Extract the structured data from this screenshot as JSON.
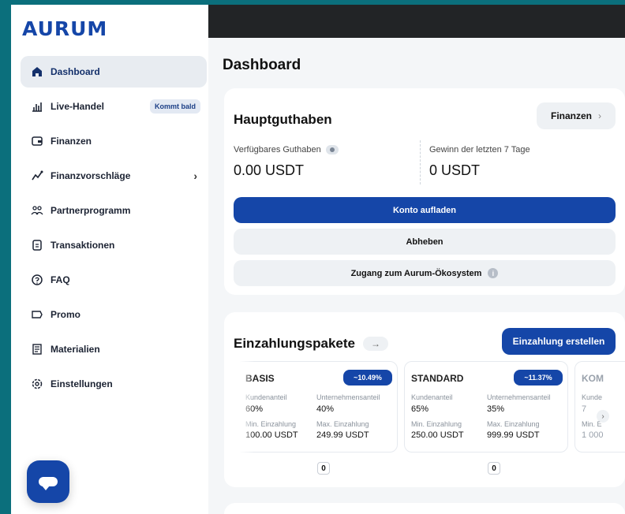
{
  "brand": {
    "logo": "AURUM",
    "color": "#1546a8"
  },
  "sidebar": {
    "items": [
      {
        "label": "Dashboard",
        "icon": "home-icon",
        "active": true
      },
      {
        "label": "Live-Handel",
        "icon": "bar-chart-icon",
        "badge": "Kommt bald"
      },
      {
        "label": "Finanzen",
        "icon": "wallet-icon"
      },
      {
        "label": "Finanzvorschläge",
        "icon": "trend-line-icon",
        "chevron": "›"
      },
      {
        "label": "Partnerprogramm",
        "icon": "partners-icon"
      },
      {
        "label": "Transaktionen",
        "icon": "document-icon"
      },
      {
        "label": "FAQ",
        "icon": "question-icon"
      },
      {
        "label": "Promo",
        "icon": "ticket-icon"
      },
      {
        "label": "Materialien",
        "icon": "materials-icon"
      },
      {
        "label": "Einstellungen",
        "icon": "settings-icon"
      }
    ],
    "chat_icon": "chat-icon"
  },
  "main": {
    "page_title": "Dashboard",
    "balance_card": {
      "title": "Hauptguthaben",
      "finance_button": "Finanzen",
      "finance_arrow": "›",
      "available_label": "Verfügbares Guthaben",
      "available_value": "0.00 USDT",
      "gain_label": "Gewinn der letzten 7 Tage",
      "gain_value": "0 USDT",
      "topup_button": "Konto aufladen",
      "withdraw_button": "Abheben",
      "ecosystem_button": "Zugang zum Aurum-Ökosystem",
      "info_glyph": "i"
    },
    "packages_card": {
      "title": "Einzahlungspakete",
      "title_arrow": "→",
      "create_button": "Einzahlung erstellen",
      "packages": [
        {
          "name": "BASIS",
          "rate": "~10.49%",
          "customer_label": "Kundenanteil",
          "customer_value": "60%",
          "company_label": "Unternehmensanteil",
          "company_value": "40%",
          "min_label": "Min. Einzahlung",
          "min_value": "100.00 USDT",
          "max_label": "Max. Einzahlung",
          "max_value": "249.99 USDT",
          "count": "0"
        },
        {
          "name": "STANDARD",
          "rate": "~11.37%",
          "customer_label": "Kundenanteil",
          "customer_value": "65%",
          "company_label": "Unternehmensanteil",
          "company_value": "35%",
          "min_label": "Min. Einzahlung",
          "min_value": "250.00 USDT",
          "max_label": "Max. Einzahlung",
          "max_value": "999.99 USDT",
          "count": "0"
        },
        {
          "name": "KOM",
          "customer_label": "Kunde",
          "customer_value": "7",
          "min_label": "Min. E",
          "min_value": "1 000"
        }
      ],
      "scroll_arrow": "›"
    }
  }
}
